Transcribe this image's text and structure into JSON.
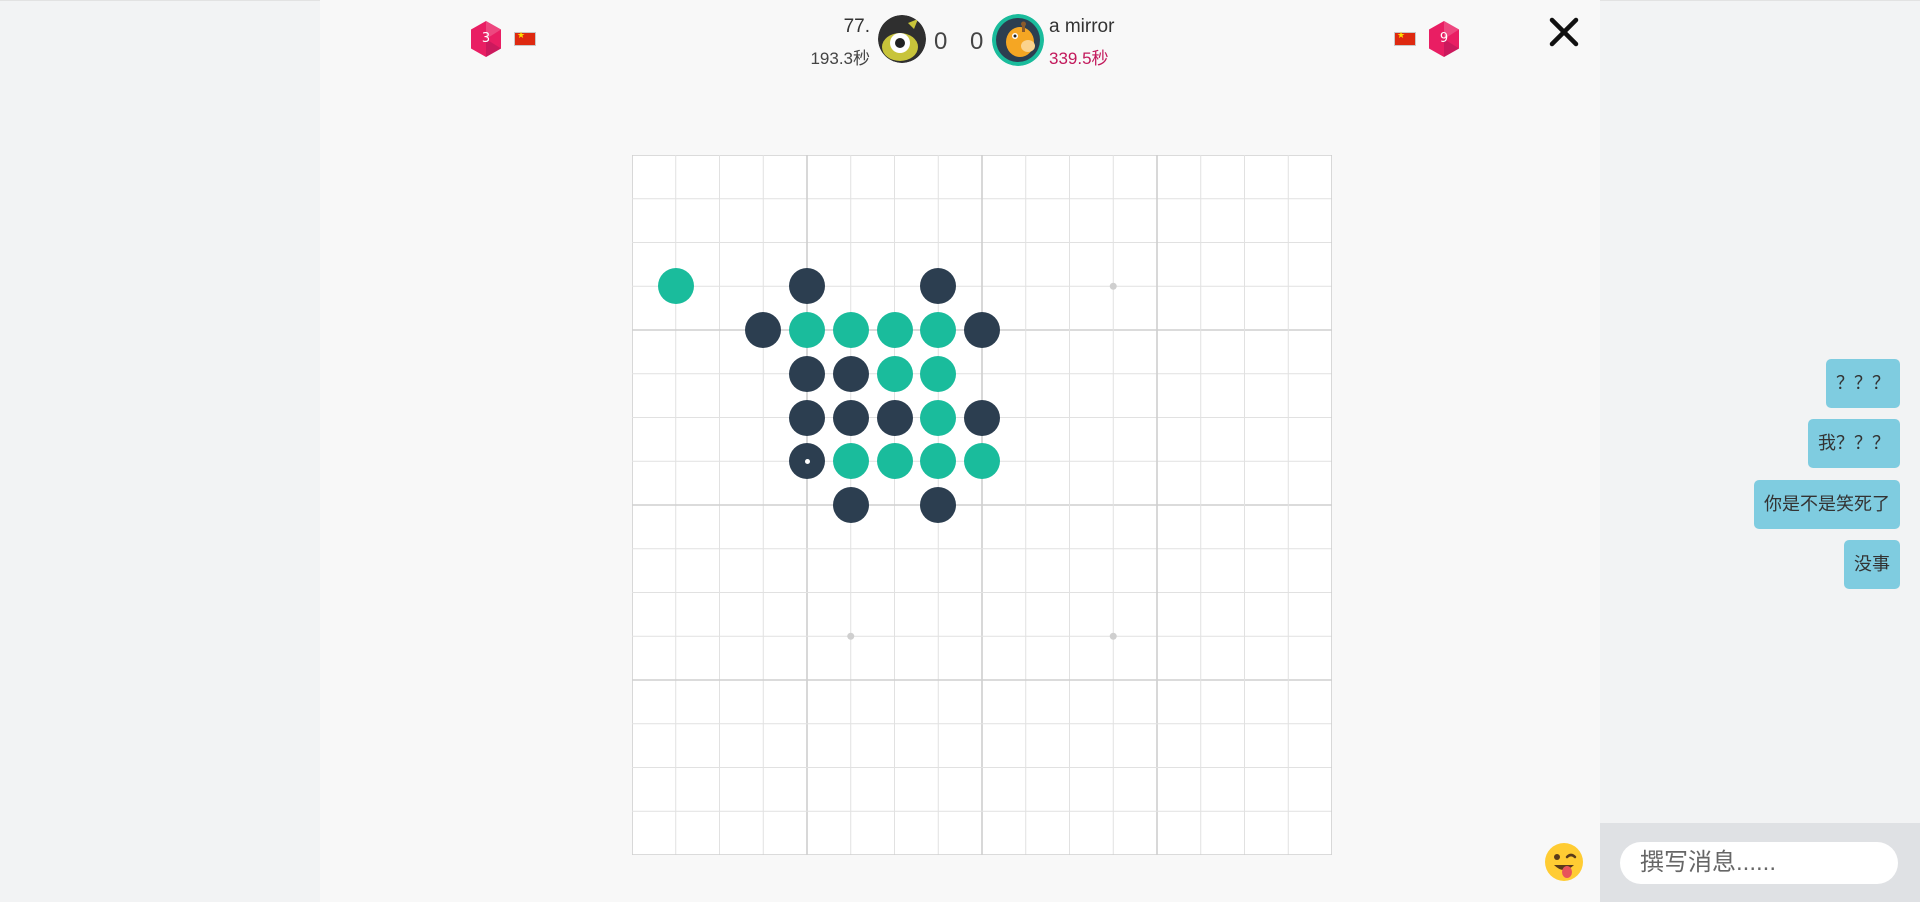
{
  "players": {
    "left": {
      "rank": "3",
      "name": "77.",
      "time": "193.3秒",
      "score": "0",
      "flag": "china-flag",
      "avatar": "one-eyed-monster-avatar"
    },
    "right": {
      "rank": "9",
      "name": "a mirror",
      "time": "339.5秒",
      "score": "0",
      "flag": "china-flag",
      "avatar": "giraffe-avatar"
    }
  },
  "colors": {
    "dark_stone": "#2c3e50",
    "teal_stone": "#1abc9c",
    "rank_badge": "#e91e63",
    "timer_active": "#c2185b",
    "chat_bubble": "#7fcce0"
  },
  "board": {
    "size": 15,
    "star_points": [
      [
        3,
        11
      ],
      [
        7,
        7
      ],
      [
        11,
        5
      ],
      [
        11,
        11
      ]
    ],
    "stones": [
      {
        "row": 3,
        "col": 1,
        "color": "teal"
      },
      {
        "row": 3,
        "col": 4,
        "color": "dark"
      },
      {
        "row": 3,
        "col": 7,
        "color": "dark"
      },
      {
        "row": 4,
        "col": 3,
        "color": "dark"
      },
      {
        "row": 4,
        "col": 4,
        "color": "teal"
      },
      {
        "row": 4,
        "col": 5,
        "color": "teal"
      },
      {
        "row": 4,
        "col": 6,
        "color": "teal"
      },
      {
        "row": 4,
        "col": 7,
        "color": "teal"
      },
      {
        "row": 4,
        "col": 8,
        "color": "dark"
      },
      {
        "row": 5,
        "col": 4,
        "color": "dark"
      },
      {
        "row": 5,
        "col": 5,
        "color": "dark"
      },
      {
        "row": 5,
        "col": 6,
        "color": "teal"
      },
      {
        "row": 5,
        "col": 7,
        "color": "teal"
      },
      {
        "row": 6,
        "col": 4,
        "color": "dark"
      },
      {
        "row": 6,
        "col": 5,
        "color": "dark"
      },
      {
        "row": 6,
        "col": 6,
        "color": "dark"
      },
      {
        "row": 6,
        "col": 7,
        "color": "teal"
      },
      {
        "row": 6,
        "col": 8,
        "color": "dark"
      },
      {
        "row": 7,
        "col": 4,
        "color": "dark",
        "last": true
      },
      {
        "row": 7,
        "col": 5,
        "color": "teal"
      },
      {
        "row": 7,
        "col": 6,
        "color": "teal"
      },
      {
        "row": 7,
        "col": 7,
        "color": "teal"
      },
      {
        "row": 7,
        "col": 8,
        "color": "teal"
      },
      {
        "row": 8,
        "col": 5,
        "color": "dark"
      },
      {
        "row": 8,
        "col": 7,
        "color": "dark"
      }
    ]
  },
  "chat": {
    "messages": [
      "？？？",
      "我？？？",
      "你是不是笑死了",
      "没事"
    ],
    "input_placeholder": "撰写消息......",
    "emoji_icon": "tongue-wink-emoji-icon"
  },
  "close_icon": "close-icon"
}
